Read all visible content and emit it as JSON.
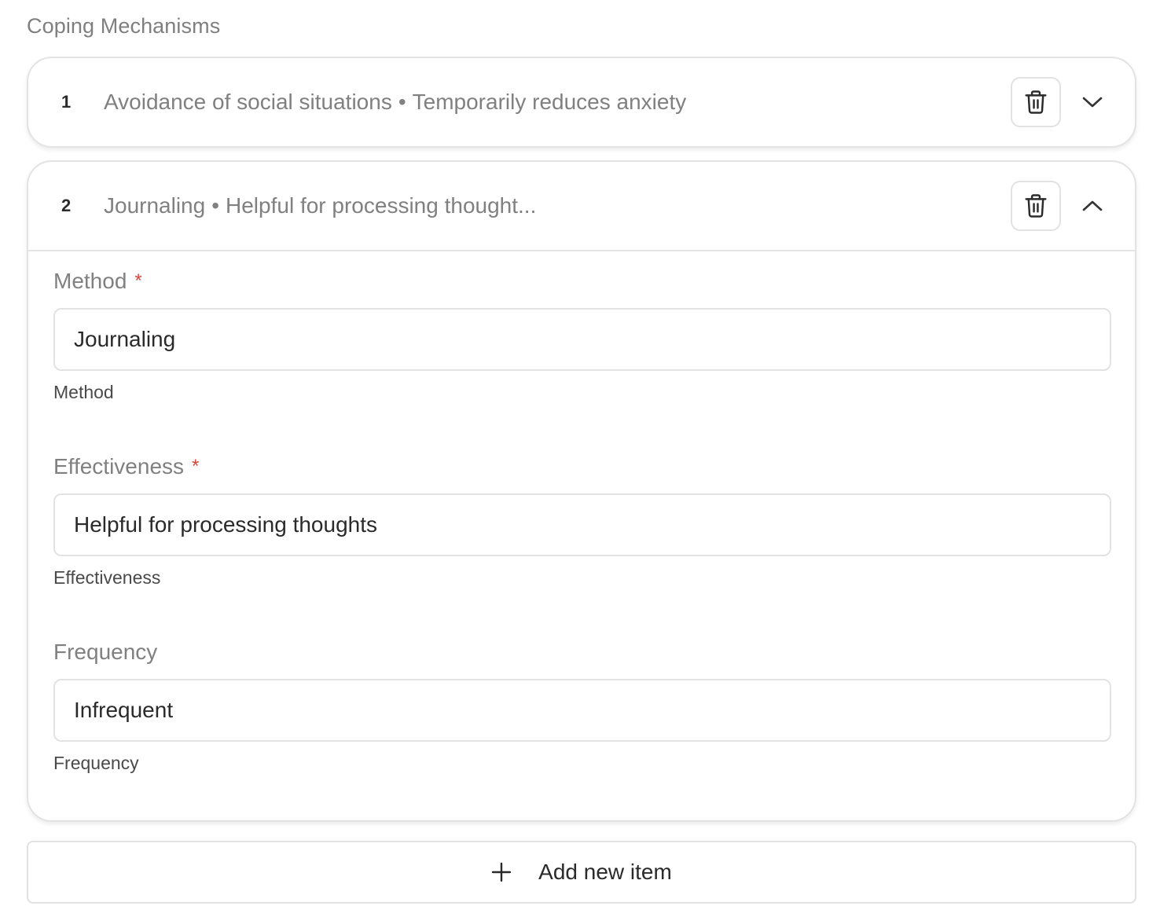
{
  "section": {
    "label": "Coping Mechanisms"
  },
  "items": [
    {
      "number": "1",
      "method": "Avoidance of social situations",
      "separator": "•",
      "effectiveness_summary": "Temporarily reduces anxiety",
      "expanded": false,
      "chevron_icon": "chevron-down-icon",
      "delete_icon": "trash-icon"
    },
    {
      "number": "2",
      "method": "Journaling",
      "separator": "•",
      "effectiveness_summary": "Helpful for processing thought...",
      "expanded": true,
      "chevron_icon": "chevron-up-icon",
      "delete_icon": "trash-icon",
      "fields": {
        "method": {
          "label": "Method",
          "required_mark": "*",
          "value": "Journaling",
          "helper": "Method"
        },
        "effectiveness": {
          "label": "Effectiveness",
          "required_mark": "*",
          "value": "Helpful for processing thoughts",
          "helper": "Effectiveness"
        },
        "frequency": {
          "label": "Frequency",
          "value": "Infrequent",
          "helper": "Frequency"
        }
      }
    }
  ],
  "add_button": {
    "label": "Add new item",
    "icon": "plus-icon"
  },
  "colors": {
    "label_gray": "#808080",
    "required_red": "#d9453b",
    "border": "#e2e2e2",
    "text": "#2a2a2a"
  }
}
